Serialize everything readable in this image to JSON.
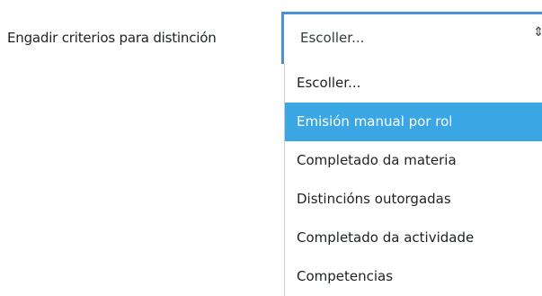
{
  "form": {
    "label": "Engadir criterios para distinción",
    "select": {
      "value": "Escoller...",
      "arrow_icon": "up-down-arrows-icon"
    }
  },
  "dropdown": {
    "highlight_color": "#3aa6e4",
    "options": [
      {
        "label": "Escoller...",
        "highlighted": false
      },
      {
        "label": "Emisión manual por rol",
        "highlighted": true
      },
      {
        "label": "Completado da materia",
        "highlighted": false
      },
      {
        "label": "Distincións outorgadas",
        "highlighted": false
      },
      {
        "label": "Completado da actividade",
        "highlighted": false
      },
      {
        "label": "Competencias",
        "highlighted": false
      }
    ]
  }
}
